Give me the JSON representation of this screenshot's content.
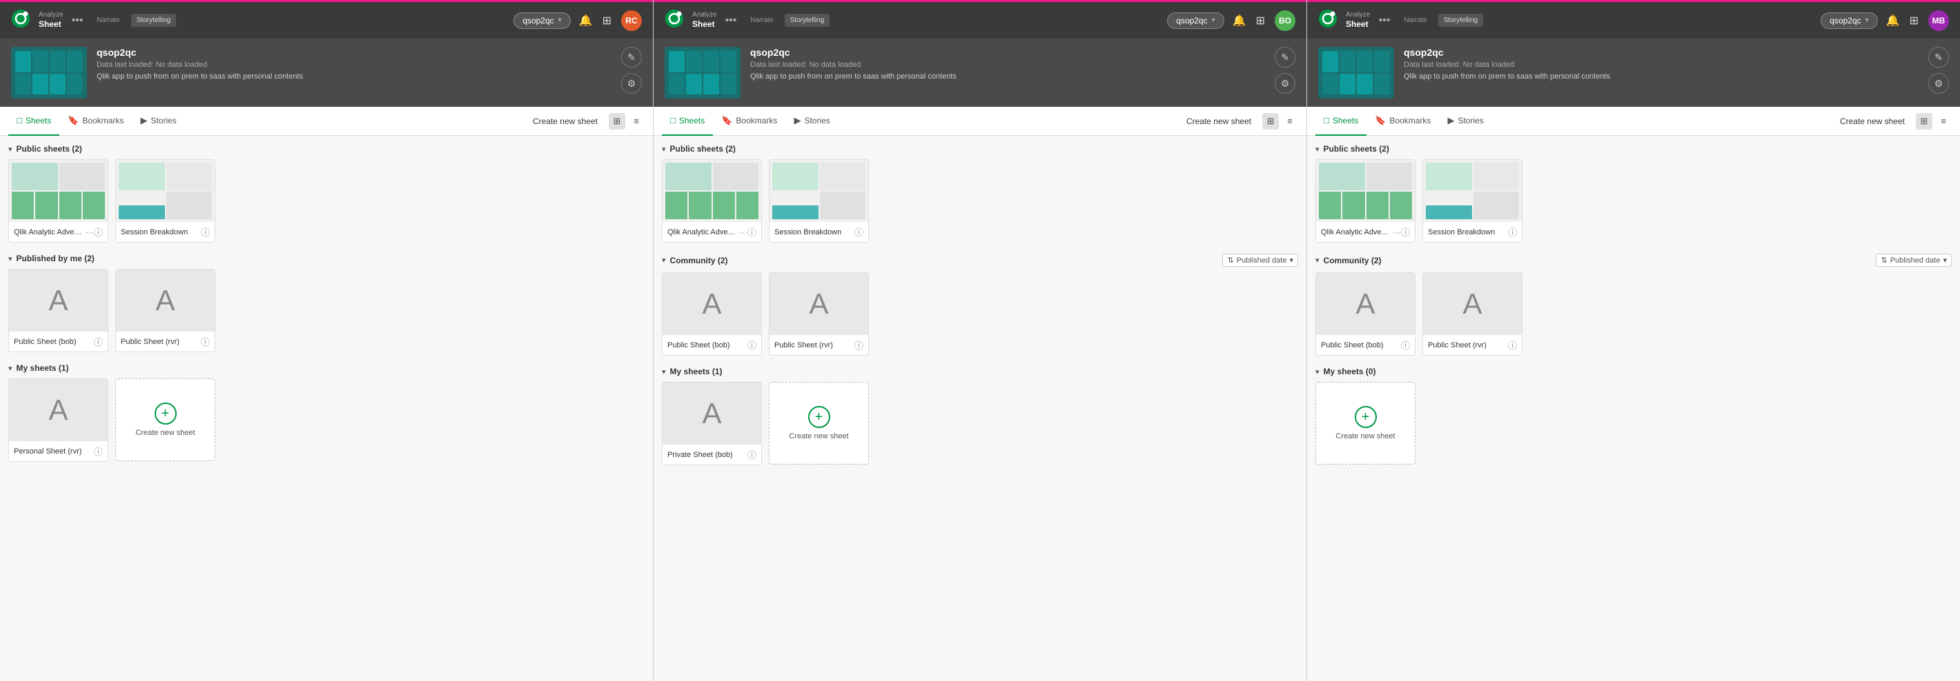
{
  "panels": [
    {
      "id": "panel-1",
      "topbar": {
        "mode_label": "Analyze",
        "mode_value": "Sheet",
        "storytelling_label": "Narrate",
        "storytelling_value": "Storytelling",
        "app_selector": "qsop2qc",
        "user_avatar": "RC",
        "user_color": "#e05a2b"
      },
      "app_header": {
        "app_name": "qsop2qc",
        "app_status": "Data last loaded: No data loaded",
        "app_desc": "Qlik app to push from on prem to saas with personal contents"
      },
      "tabs": [
        "Sheets",
        "Bookmarks",
        "Stories"
      ],
      "active_tab": "Sheets",
      "create_label": "Create new sheet",
      "sections": [
        {
          "id": "public-sheets",
          "title": "Public sheets (2)",
          "collapsed": false,
          "sort": null,
          "cards": [
            {
              "type": "thumb",
              "name": "Qlik Analytic Adventure",
              "has_ellipsis": true,
              "thumb_type": "chart"
            },
            {
              "type": "thumb",
              "name": "Session Breakdown",
              "has_ellipsis": false,
              "thumb_type": "chart2"
            }
          ]
        },
        {
          "id": "published-by-me",
          "title": "Published by me (2)",
          "collapsed": false,
          "sort": null,
          "cards": [
            {
              "type": "letter",
              "letter": "A",
              "name": "Public Sheet (bob)",
              "has_ellipsis": false
            },
            {
              "type": "letter",
              "letter": "A",
              "name": "Public Sheet (rvr)",
              "has_ellipsis": false
            }
          ]
        },
        {
          "id": "my-sheets",
          "title": "My sheets (1)",
          "collapsed": false,
          "sort": null,
          "cards": [
            {
              "type": "letter",
              "letter": "A",
              "name": "Personal Sheet (rvr)",
              "has_ellipsis": false
            },
            {
              "type": "create",
              "name": "Create new sheet"
            }
          ]
        }
      ]
    },
    {
      "id": "panel-2",
      "topbar": {
        "mode_label": "Analyze",
        "mode_value": "Sheet",
        "storytelling_label": "Narrate",
        "storytelling_value": "Storytelling",
        "app_selector": "qsop2qc",
        "user_avatar": "BO",
        "user_color": "#4caf50"
      },
      "app_header": {
        "app_name": "qsop2qc",
        "app_status": "Data last loaded: No data loaded",
        "app_desc": "Qlik app to push from on prem to saas with personal contents"
      },
      "tabs": [
        "Sheets",
        "Bookmarks",
        "Stories"
      ],
      "active_tab": "Sheets",
      "create_label": "Create new sheet",
      "sections": [
        {
          "id": "public-sheets",
          "title": "Public sheets (2)",
          "collapsed": false,
          "sort": null,
          "cards": [
            {
              "type": "thumb",
              "name": "Qlik Analytic Adventure",
              "has_ellipsis": true,
              "thumb_type": "chart"
            },
            {
              "type": "thumb",
              "name": "Session Breakdown",
              "has_ellipsis": false,
              "thumb_type": "chart2"
            }
          ]
        },
        {
          "id": "community",
          "title": "Community (2)",
          "collapsed": false,
          "sort": "Published date",
          "cards": [
            {
              "type": "letter",
              "letter": "A",
              "name": "Public Sheet (bob)",
              "has_ellipsis": false
            },
            {
              "type": "letter",
              "letter": "A",
              "name": "Public Sheet (rvr)",
              "has_ellipsis": false
            }
          ]
        },
        {
          "id": "my-sheets",
          "title": "My sheets (1)",
          "collapsed": false,
          "sort": null,
          "cards": [
            {
              "type": "letter",
              "letter": "A",
              "name": "Private Sheet (bob)",
              "has_ellipsis": false
            },
            {
              "type": "create",
              "name": "Create new sheet"
            }
          ]
        }
      ]
    },
    {
      "id": "panel-3",
      "topbar": {
        "mode_label": "Analyze",
        "mode_value": "Sheet",
        "storytelling_label": "Narrate",
        "storytelling_value": "Storytelling",
        "app_selector": "qsop2qc",
        "user_avatar": "MB",
        "user_color": "#9c27b0"
      },
      "app_header": {
        "app_name": "qsop2qc",
        "app_status": "Data last loaded: No data loaded",
        "app_desc": "Qlik app to push from on prem to saas with personal contents"
      },
      "tabs": [
        "Sheets",
        "Bookmarks",
        "Stories"
      ],
      "active_tab": "Sheets",
      "create_label": "Create new sheet",
      "sections": [
        {
          "id": "public-sheets",
          "title": "Public sheets (2)",
          "collapsed": false,
          "sort": null,
          "cards": [
            {
              "type": "thumb",
              "name": "Qlik Analytic Adventure",
              "has_ellipsis": true,
              "thumb_type": "chart"
            },
            {
              "type": "thumb",
              "name": "Session Breakdown",
              "has_ellipsis": false,
              "thumb_type": "chart2"
            }
          ]
        },
        {
          "id": "community",
          "title": "Community (2)",
          "collapsed": false,
          "sort": "Published date",
          "cards": [
            {
              "type": "letter",
              "letter": "A",
              "name": "Public Sheet (bob)",
              "has_ellipsis": false
            },
            {
              "type": "letter",
              "letter": "A",
              "name": "Public Sheet (rvr)",
              "has_ellipsis": false
            }
          ]
        },
        {
          "id": "my-sheets",
          "title": "My sheets (0)",
          "collapsed": false,
          "sort": null,
          "cards": [
            {
              "type": "create",
              "name": "Create new sheet"
            }
          ]
        }
      ]
    }
  ],
  "icons": {
    "chevron_down": "▾",
    "chevron_right": "▸",
    "grid_view": "⊞",
    "list_view": "≡",
    "bell": "🔔",
    "apps": "⠿",
    "info": "ⓘ",
    "edit": "✎",
    "settings": "⚙",
    "dots": "•••",
    "bookmark": "🔖",
    "stories": "▶",
    "sheets": "□",
    "plus": "+",
    "sort": "⇅"
  }
}
